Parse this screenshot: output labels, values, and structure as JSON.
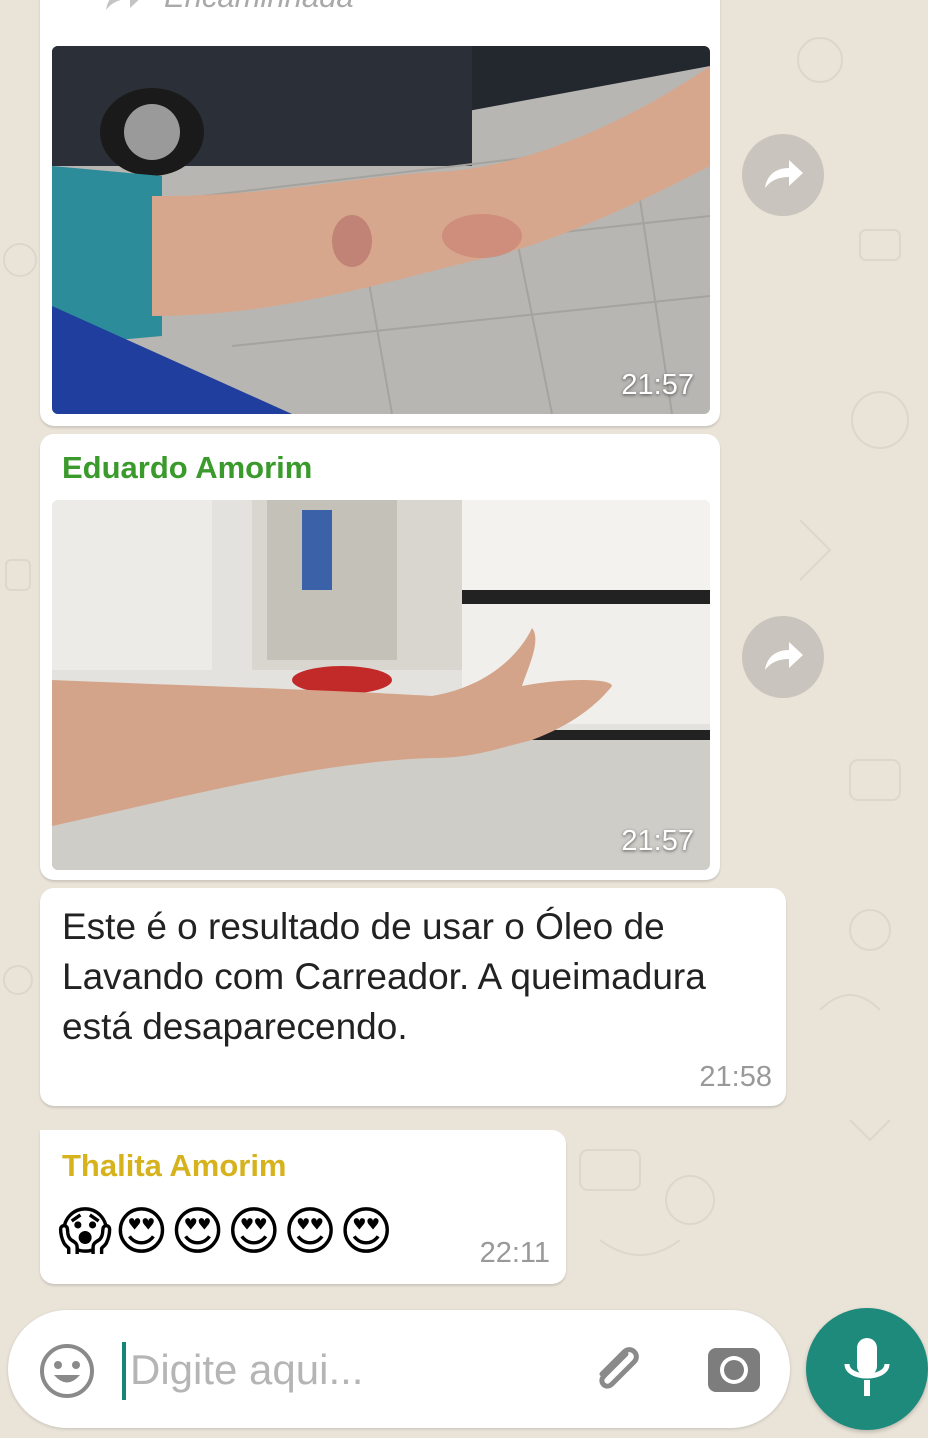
{
  "messages": [
    {
      "type": "image",
      "forwarded_label": "Encaminhada",
      "time": "21:57",
      "image_desc": "arm-burn-street"
    },
    {
      "type": "image",
      "sender": "Eduardo Amorim",
      "sender_color": "#3a9a2c",
      "time": "21:57",
      "image_desc": "arm-kitchen"
    },
    {
      "type": "text",
      "text": "Este é o resultado de usar o Óleo de Lavando com Carreador.  A queimadura está desaparecendo.",
      "time": "21:58"
    },
    {
      "type": "text",
      "sender": "Thalita Amorim",
      "sender_color": "#d6b21c",
      "text": "😱😍😍😍😍😍",
      "time": "22:11"
    }
  ],
  "composer": {
    "placeholder": "Digite aqui...",
    "icons": [
      "smiley-icon",
      "paperclip-icon",
      "camera-icon",
      "microphone-icon"
    ]
  },
  "colors": {
    "accent": "#1e8a7c",
    "background": "#e9e3d8",
    "bubble": "#ffffff"
  }
}
